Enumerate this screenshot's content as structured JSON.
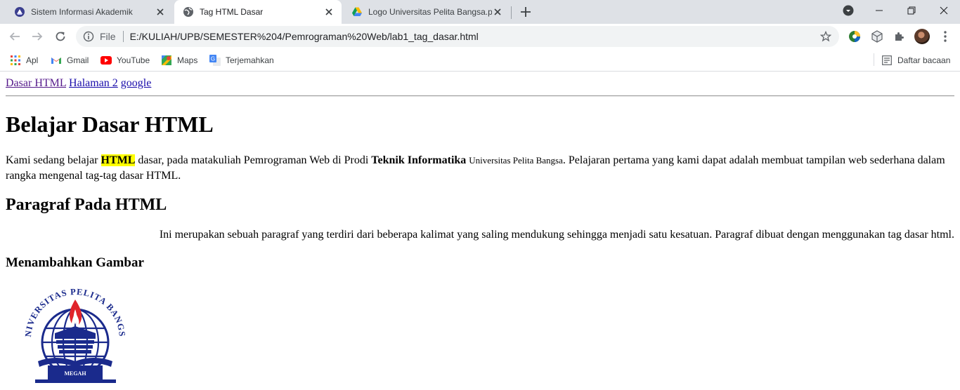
{
  "browser": {
    "tabs": [
      {
        "title": "Sistem Informasi Akademik",
        "icon": "university-favicon-icon",
        "active": false
      },
      {
        "title": "Tag HTML Dasar",
        "icon": "globe-icon",
        "active": true
      },
      {
        "title": "Logo Universitas Pelita Bangsa.png",
        "icon": "google-drive-icon",
        "active": false
      }
    ],
    "address": {
      "scheme_label": "File",
      "url": "E:/KULIAH/UPB/SEMESTER%204/Pemrograman%20Web/lab1_tag_dasar.html"
    },
    "bookmarks": [
      {
        "label": "Apl",
        "icon": "apps-grid-icon"
      },
      {
        "label": "Gmail",
        "icon": "gmail-icon"
      },
      {
        "label": "YouTube",
        "icon": "youtube-icon"
      },
      {
        "label": "Maps",
        "icon": "maps-icon"
      },
      {
        "label": "Terjemahkan",
        "icon": "translate-icon"
      }
    ],
    "reading_list_label": "Daftar bacaan"
  },
  "page": {
    "nav_links": [
      "Dasar HTML",
      "Halaman 2",
      "google"
    ],
    "heading1": "Belajar Dasar HTML",
    "intro": {
      "t1": "Kami sedang belajar ",
      "mark": "HTML",
      "t2": " dasar, pada matakuliah Pemrograman Web di Prodi ",
      "bold": "Teknik Informatika",
      "t3": " ",
      "small": "Universitas Pelita Bangsa",
      "t4": ". Pelajaran pertama yang kami dapat adalah membuat tampilan web sederhana dalam rangka mengenal tag-tag dasar HTML."
    },
    "heading2": "Paragraf Pada HTML",
    "paragraph2": "Ini merupakan sebuah paragraf yang terdiri dari beberapa kalimat yang saling mendukung sehingga menjadi satu kesatuan. Paragraf dibuat dengan menggunakan tag dasar html.",
    "heading3": "Menambahkan Gambar",
    "logo": {
      "ring_text": "UNIVERSITAS PELITA BANGSA",
      "motto": "MEGAH",
      "primary_color": "#1a2a8c",
      "flame_color": "#e0242a"
    }
  }
}
